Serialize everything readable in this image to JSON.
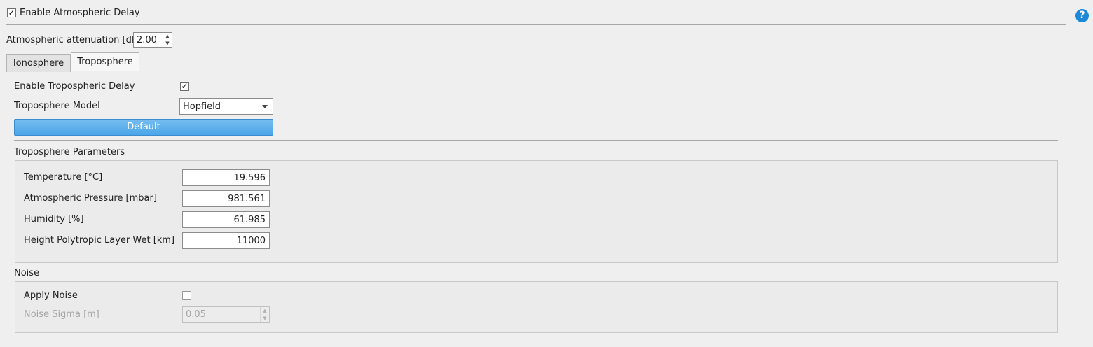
{
  "header": {
    "enable_atmospheric_delay_label": "Enable Atmospheric Delay",
    "enable_atmospheric_delay_checked": true,
    "help_icon": "help-circle-icon",
    "help_icon_glyph": "?"
  },
  "attenuation": {
    "label": "Atmospheric attenuation [dB]",
    "value": "2.00"
  },
  "tabs": [
    {
      "label": "Ionosphere",
      "active": false
    },
    {
      "label": "Troposphere",
      "active": true
    }
  ],
  "troposphere": {
    "enable_label": "Enable Tropospheric Delay",
    "enable_checked": true,
    "model_label": "Troposphere Model",
    "model_value": "Hopfield",
    "default_button": "Default",
    "params_title": "Troposphere Parameters",
    "params": [
      {
        "label": "Temperature [°C]",
        "value": "19.596"
      },
      {
        "label": "Atmospheric Pressure [mbar]",
        "value": "981.561"
      },
      {
        "label": "Humidity [%]",
        "value": "61.985"
      },
      {
        "label": "Height Polytropic Layer Wet [km]",
        "value": "11000"
      }
    ]
  },
  "noise": {
    "title": "Noise",
    "apply_label": "Apply Noise",
    "apply_checked": false,
    "sigma_label": "Noise Sigma [m]",
    "sigma_value": "0.05"
  },
  "glyphs": {
    "check": "✓",
    "up": "▲",
    "down": "▼"
  },
  "colors": {
    "accent": "#4aa5e8",
    "help": "#1c88d8",
    "background": "#efefef"
  }
}
